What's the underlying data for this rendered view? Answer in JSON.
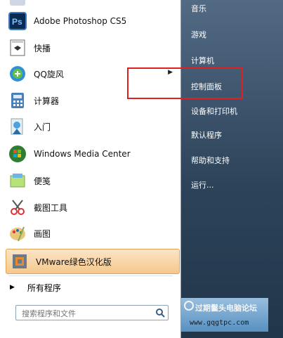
{
  "left_items": [
    {
      "label": "Adobe Photoshop CS5",
      "icon": "photoshop-icon"
    },
    {
      "label": "快播",
      "icon": "kuaibo-icon"
    },
    {
      "label": "QQ旋风",
      "icon": "qq-xuanfeng-icon",
      "has_submenu": true
    },
    {
      "label": "计算器",
      "icon": "calculator-icon"
    },
    {
      "label": "入门",
      "icon": "getting-started-icon"
    },
    {
      "label": "Windows Media Center",
      "icon": "windows-media-center-icon"
    },
    {
      "label": "便笺",
      "icon": "sticky-notes-icon"
    },
    {
      "label": "截图工具",
      "icon": "snipping-tool-icon"
    },
    {
      "label": "画图",
      "icon": "paint-icon"
    },
    {
      "label": "VMware绿色汉化版",
      "icon": "vmware-icon",
      "highlighted": true
    }
  ],
  "all_programs": "所有程序",
  "search": {
    "placeholder": "搜索程序和文件"
  },
  "right_items": [
    "音乐",
    "游戏",
    "计算机",
    "控制面板",
    "设备和打印机",
    "默认程序",
    "帮助和支持",
    "运行..."
  ],
  "watermark": {
    "line1": "过期鬣头电脑论坛",
    "line2": "www.gqgtpc.com"
  },
  "colors": {
    "highlight_red": "#e02020",
    "vmware_highlight": "#f6c88a"
  }
}
